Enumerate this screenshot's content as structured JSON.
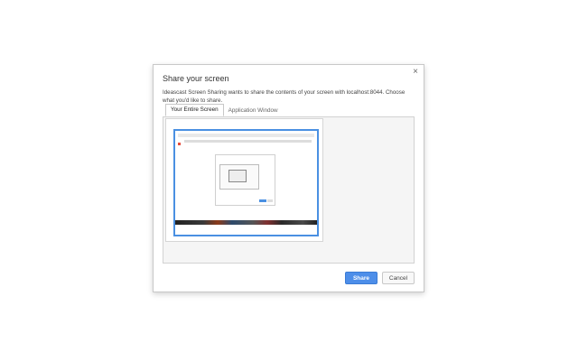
{
  "dialog": {
    "title": "Share your screen",
    "close_glyph": "×",
    "description": "Ideascast Screen Sharing wants to share the contents of your screen with localhost:8044. Choose what you'd like to share.",
    "tabs": [
      {
        "label": "Your Entire Screen",
        "active": true
      },
      {
        "label": "Application Window",
        "active": false
      }
    ],
    "buttons": {
      "share_label": "Share",
      "cancel_label": "Cancel"
    }
  },
  "colors": {
    "accent": "#4a90e2",
    "share_button": "#4d8ee9"
  }
}
